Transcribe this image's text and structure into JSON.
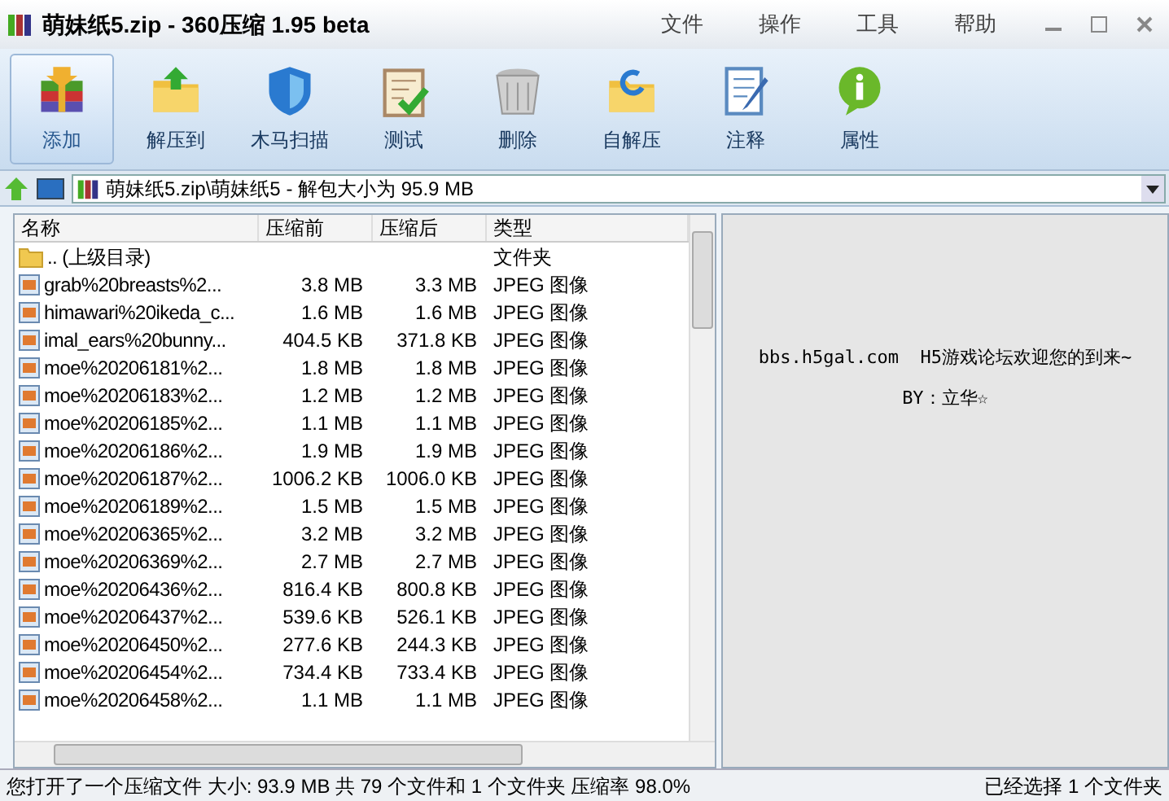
{
  "window": {
    "title": "萌妹纸5.zip - 360压缩 1.95 beta"
  },
  "menu": [
    "文件",
    "操作",
    "工具",
    "帮助"
  ],
  "toolbar": [
    {
      "label": "添加",
      "kind": "add",
      "selected": true
    },
    {
      "label": "解压到",
      "kind": "extract",
      "selected": false
    },
    {
      "label": "木马扫描",
      "kind": "scan",
      "selected": false
    },
    {
      "label": "测试",
      "kind": "test",
      "selected": false
    },
    {
      "label": "删除",
      "kind": "delete",
      "selected": false
    },
    {
      "label": "自解压",
      "kind": "sfx",
      "selected": false
    },
    {
      "label": "注释",
      "kind": "comment",
      "selected": false
    },
    {
      "label": "属性",
      "kind": "info",
      "selected": false
    }
  ],
  "address": {
    "path": "萌妹纸5.zip\\萌妹纸5 - 解包大小为 95.9 MB"
  },
  "table": {
    "columns": [
      "名称",
      "压缩前",
      "压缩后",
      "类型"
    ],
    "rows": [
      {
        "kind": "folder",
        "name": ".. (上级目录)",
        "before": "",
        "after": "",
        "type": "文件夹"
      },
      {
        "kind": "file",
        "name": "grab%20breasts%2...",
        "before": "3.8 MB",
        "after": "3.3 MB",
        "type": "JPEG 图像"
      },
      {
        "kind": "file",
        "name": "himawari%20ikeda_c...",
        "before": "1.6 MB",
        "after": "1.6 MB",
        "type": "JPEG 图像"
      },
      {
        "kind": "file",
        "name": "imal_ears%20bunny...",
        "before": "404.5 KB",
        "after": "371.8 KB",
        "type": "JPEG 图像"
      },
      {
        "kind": "file",
        "name": "moe%20206181%2...",
        "before": "1.8 MB",
        "after": "1.8 MB",
        "type": "JPEG 图像"
      },
      {
        "kind": "file",
        "name": "moe%20206183%2...",
        "before": "1.2 MB",
        "after": "1.2 MB",
        "type": "JPEG 图像"
      },
      {
        "kind": "file",
        "name": "moe%20206185%2...",
        "before": "1.1 MB",
        "after": "1.1 MB",
        "type": "JPEG 图像"
      },
      {
        "kind": "file",
        "name": "moe%20206186%2...",
        "before": "1.9 MB",
        "after": "1.9 MB",
        "type": "JPEG 图像"
      },
      {
        "kind": "file",
        "name": "moe%20206187%2...",
        "before": "1006.2 KB",
        "after": "1006.0 KB",
        "type": "JPEG 图像"
      },
      {
        "kind": "file",
        "name": "moe%20206189%2...",
        "before": "1.5 MB",
        "after": "1.5 MB",
        "type": "JPEG 图像"
      },
      {
        "kind": "file",
        "name": "moe%20206365%2...",
        "before": "3.2 MB",
        "after": "3.2 MB",
        "type": "JPEG 图像"
      },
      {
        "kind": "file",
        "name": "moe%20206369%2...",
        "before": "2.7 MB",
        "after": "2.7 MB",
        "type": "JPEG 图像"
      },
      {
        "kind": "file",
        "name": "moe%20206436%2...",
        "before": "816.4 KB",
        "after": "800.8 KB",
        "type": "JPEG 图像"
      },
      {
        "kind": "file",
        "name": "moe%20206437%2...",
        "before": "539.6 KB",
        "after": "526.1 KB",
        "type": "JPEG 图像"
      },
      {
        "kind": "file",
        "name": "moe%20206450%2...",
        "before": "277.6 KB",
        "after": "244.3 KB",
        "type": "JPEG 图像"
      },
      {
        "kind": "file",
        "name": "moe%20206454%2...",
        "before": "734.4 KB",
        "after": "733.4 KB",
        "type": "JPEG 图像"
      },
      {
        "kind": "file",
        "name": "moe%20206458%2...",
        "before": "1.1 MB",
        "after": "1.1 MB",
        "type": "JPEG 图像"
      }
    ]
  },
  "comment": {
    "lines": [
      "bbs.h5gal.com  H5游戏论坛欢迎您的到来~",
      "BY：立华☆"
    ]
  },
  "status_bar": {
    "left": "您打开了一个压缩文件 大小: 93.9 MB 共 79 个文件和 1 个文件夹 压缩率 98.0%",
    "right": "已经选择 1 个文件夹"
  }
}
